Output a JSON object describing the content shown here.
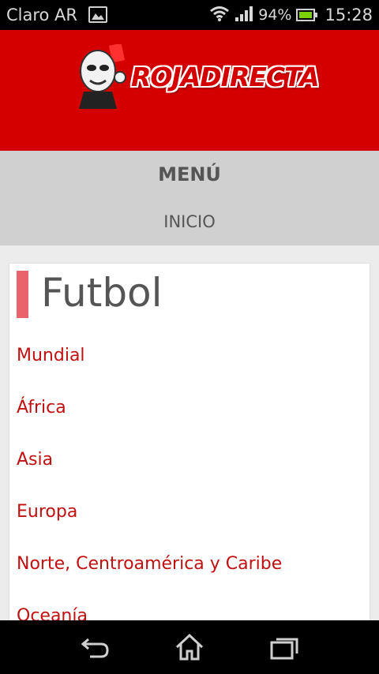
{
  "status_bar": {
    "carrier": "Claro AR",
    "battery_percent": "94%",
    "time": "15:28",
    "icons": [
      "image-icon",
      "wifi-icon",
      "signal-icon",
      "battery-icon"
    ]
  },
  "header": {
    "logo_text": "ROJADIRECTA",
    "background_color": "#d40000"
  },
  "menu": {
    "title": "MENÚ",
    "items": [
      "INICIO"
    ]
  },
  "section": {
    "title": "Futbol",
    "accent_color": "#e8636b",
    "links": [
      "Mundial",
      "África",
      "Asia",
      "Europa",
      "Norte, Centroamérica y Caribe",
      "Oceanía"
    ]
  },
  "nav_bar": {
    "buttons": [
      "back-icon",
      "home-icon",
      "recent-apps-icon"
    ]
  }
}
